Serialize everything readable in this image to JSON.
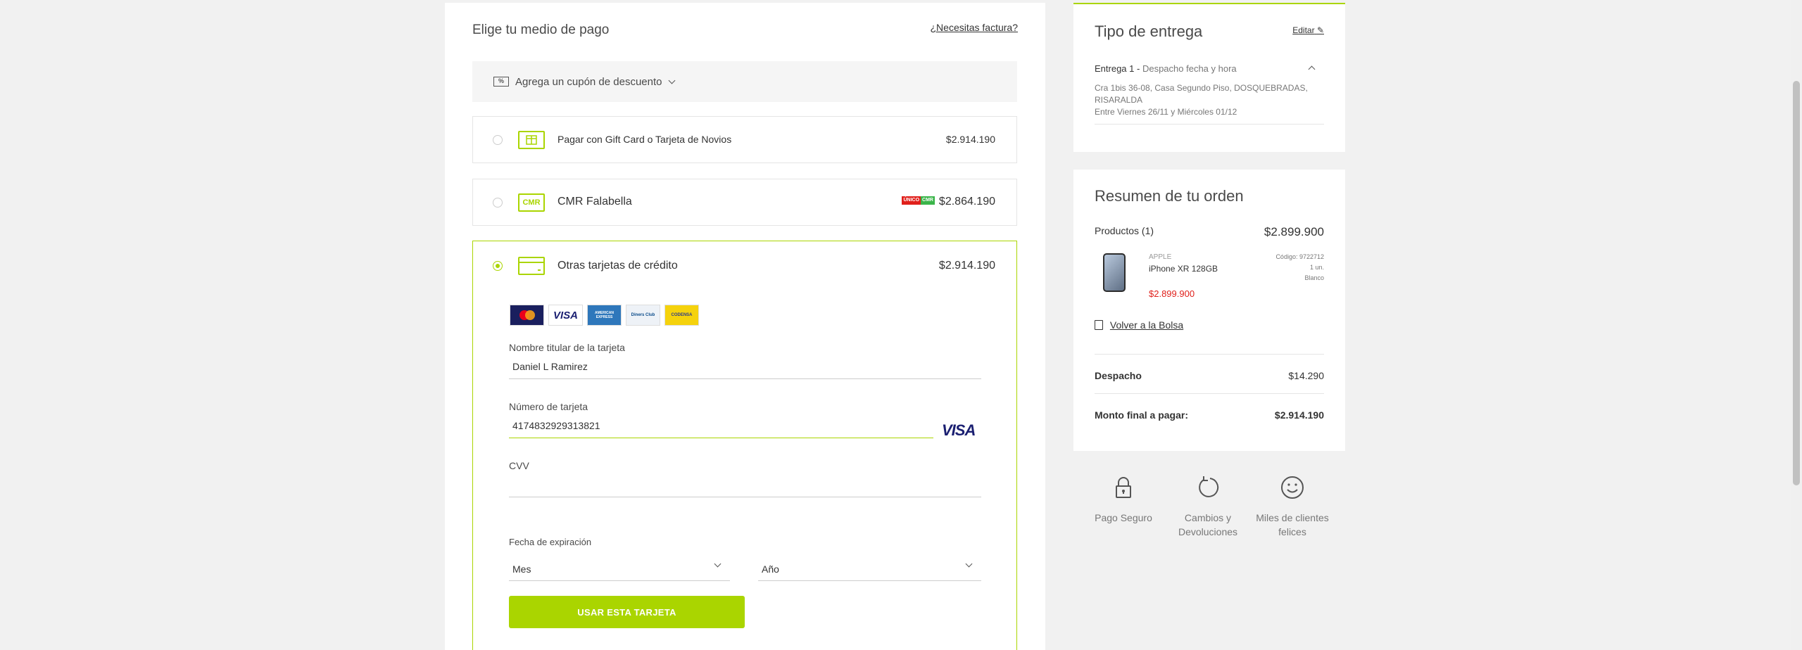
{
  "payment": {
    "title": "Elige tu medio de pago",
    "invoice_link": "¿Necesitas factura?",
    "coupon_icon": "%",
    "coupon_label": "Agrega un cupón de descuento",
    "options": [
      {
        "icon": "gift-card-icon",
        "icon_text": "",
        "label": "Pagar con Gift Card o Tarjeta de Novios",
        "price": "$2.914.190"
      },
      {
        "icon": "cmr-icon",
        "icon_text": "CMR",
        "label": "CMR Falabella",
        "price": "$2.864.190",
        "badge_left": "ÚNICO",
        "badge_right": "CMR"
      },
      {
        "icon": "credit-card-icon",
        "icon_text": "",
        "label": "Otras tarjetas de crédito",
        "price": "$2.914.190"
      }
    ],
    "card_logos": [
      "MasterCard",
      "VISA",
      "AMERICAN EXPRESS",
      "Diners Club",
      "CODENSA"
    ],
    "form": {
      "holder_label": "Nombre titular de la tarjeta",
      "holder_value": "Daniel L Ramirez",
      "number_label": "Número de tarjeta",
      "number_value": "4174832929313821",
      "number_brand": "VISA",
      "cvv_label": "CVV",
      "cvv_value": "",
      "expiry_label": "Fecha de expiración",
      "month_value": "Mes",
      "year_value": "Año",
      "submit_label": "USAR ESTA TARJETA"
    }
  },
  "delivery": {
    "title": "Tipo de entrega",
    "edit_label": "Editar",
    "entry_label": "Entrega 1 -",
    "entry_type": "Despacho fecha y hora",
    "address_line1": "Cra 1bis 36-08, Casa Segundo Piso, DOSQUEBRADAS, RISARALDA",
    "address_line2": "Entre Viernes 26/11 y Miércoles 01/12"
  },
  "summary": {
    "title": "Resumen de tu orden",
    "products_label": "Productos (1)",
    "products_value": "$2.899.900",
    "product": {
      "brand": "APPLE",
      "name": "iPhone XR 128GB",
      "price": "$2.899.900",
      "code": "Código: 9722712",
      "qty": "1 un.",
      "color": "Blanco"
    },
    "back_label": "Volver a la Bolsa",
    "shipping_label": "Despacho",
    "shipping_value": "$14.290",
    "total_label": "Monto final a pagar:",
    "total_value": "$2.914.190"
  },
  "trust": [
    {
      "icon": "lock-icon",
      "label": "Pago Seguro"
    },
    {
      "icon": "refresh-icon",
      "label": "Cambios y Devoluciones"
    },
    {
      "icon": "smiley-icon",
      "label": "Miles de clientes felices"
    }
  ],
  "colors": {
    "accent": "#aad500",
    "price_red": "#e0201b",
    "background": "#f1f1f1"
  }
}
